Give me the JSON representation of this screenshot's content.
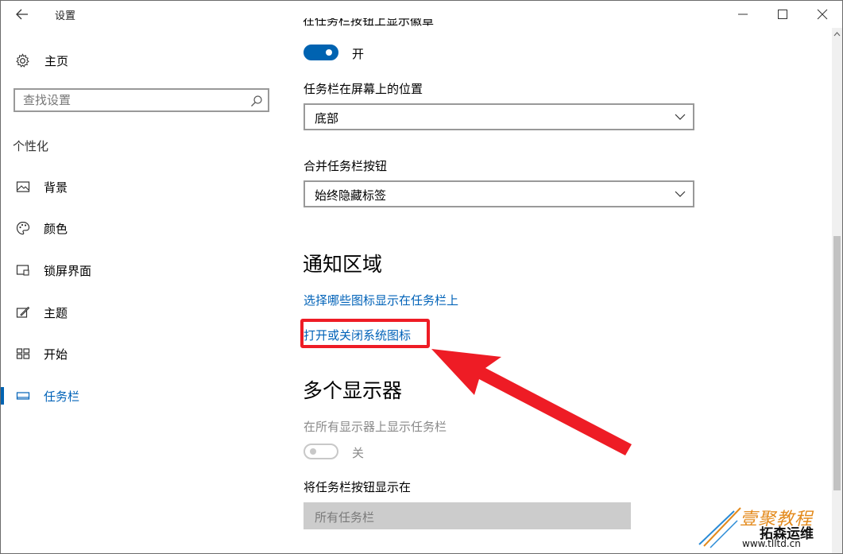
{
  "window": {
    "title": "设置"
  },
  "sidebar": {
    "home_label": "主页",
    "search_placeholder": "查找设置",
    "section_label": "个性化",
    "items": [
      {
        "label": "背景",
        "icon": "picture-icon"
      },
      {
        "label": "颜色",
        "icon": "palette-icon"
      },
      {
        "label": "锁屏界面",
        "icon": "lock-screen-icon"
      },
      {
        "label": "主题",
        "icon": "theme-icon"
      },
      {
        "label": "开始",
        "icon": "start-icon"
      },
      {
        "label": "任务栏",
        "icon": "taskbar-icon",
        "active": true
      }
    ]
  },
  "content": {
    "cut_label": "在任务栏按钮上显示徽章",
    "badge_toggle": {
      "state_label": "开",
      "on": true
    },
    "position_label": "任务栏在屏幕上的位置",
    "position_value": "底部",
    "combine_label": "合并任务栏按钮",
    "combine_value": "始终隐藏标签",
    "notification_heading": "通知区域",
    "link_select_icons": "选择哪些图标显示在任务栏上",
    "link_system_icons": "打开或关闭系统图标",
    "multi_display_heading": "多个显示器",
    "show_all_displays_label": "在所有显示器上显示任务栏",
    "show_all_toggle": {
      "state_label": "关",
      "on": false
    },
    "show_buttons_label": "将任务栏按钮显示在",
    "show_buttons_value": "所有任务栏"
  },
  "watermark": {
    "line1": "壹聚教程",
    "line2": "拓森运维",
    "url": "www.tlltd.cn"
  },
  "colors": {
    "accent": "#0063b1",
    "link": "#0062b8",
    "highlight": "#ee1c25"
  }
}
